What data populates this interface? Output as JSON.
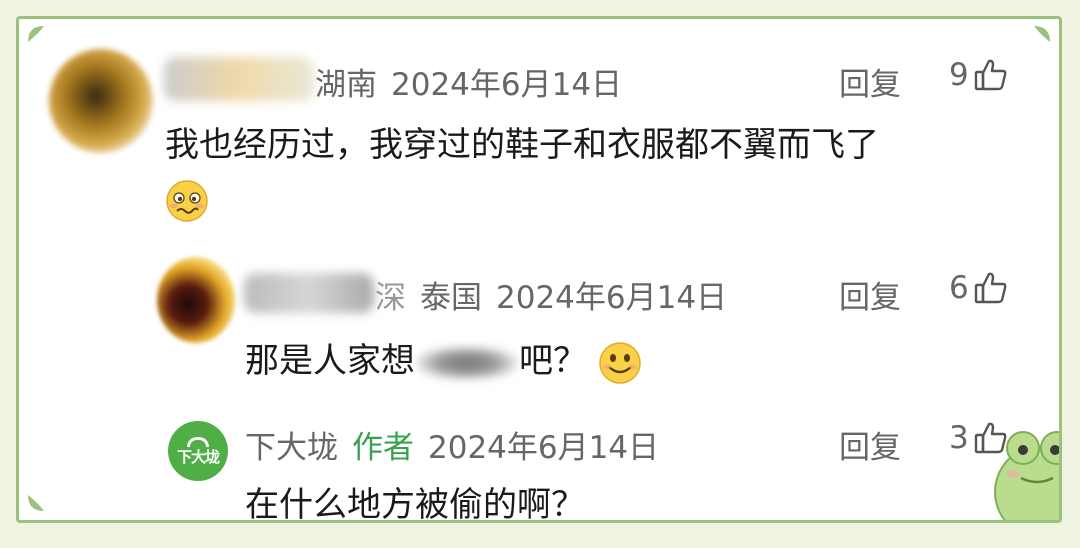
{
  "comments": [
    {
      "location": "湖南",
      "date": "2024年6月14日",
      "reply_label": "回复",
      "likes": "9",
      "text": "我也经历过，我穿过的鞋子和衣服都不翼而飞了",
      "emoji": "woozy-face"
    },
    {
      "name_partial": "深",
      "location": "泰国",
      "date": "2024年6月14日",
      "reply_label": "回复",
      "likes": "6",
      "text_before": "那是人家想",
      "text_after": "吧？",
      "emoji": "smiling-face"
    },
    {
      "name": "下大垅",
      "author_badge": "作者",
      "date": "2024年6月14日",
      "reply_label": "回复",
      "likes": "3",
      "text": "在什么地方被偷的啊？",
      "avatar_text": "下大垅"
    }
  ],
  "colors": {
    "frame_border": "#9cc17c",
    "author_green": "#3aa14c",
    "avatar_green": "#4fae46",
    "meta_gray": "#666666"
  }
}
